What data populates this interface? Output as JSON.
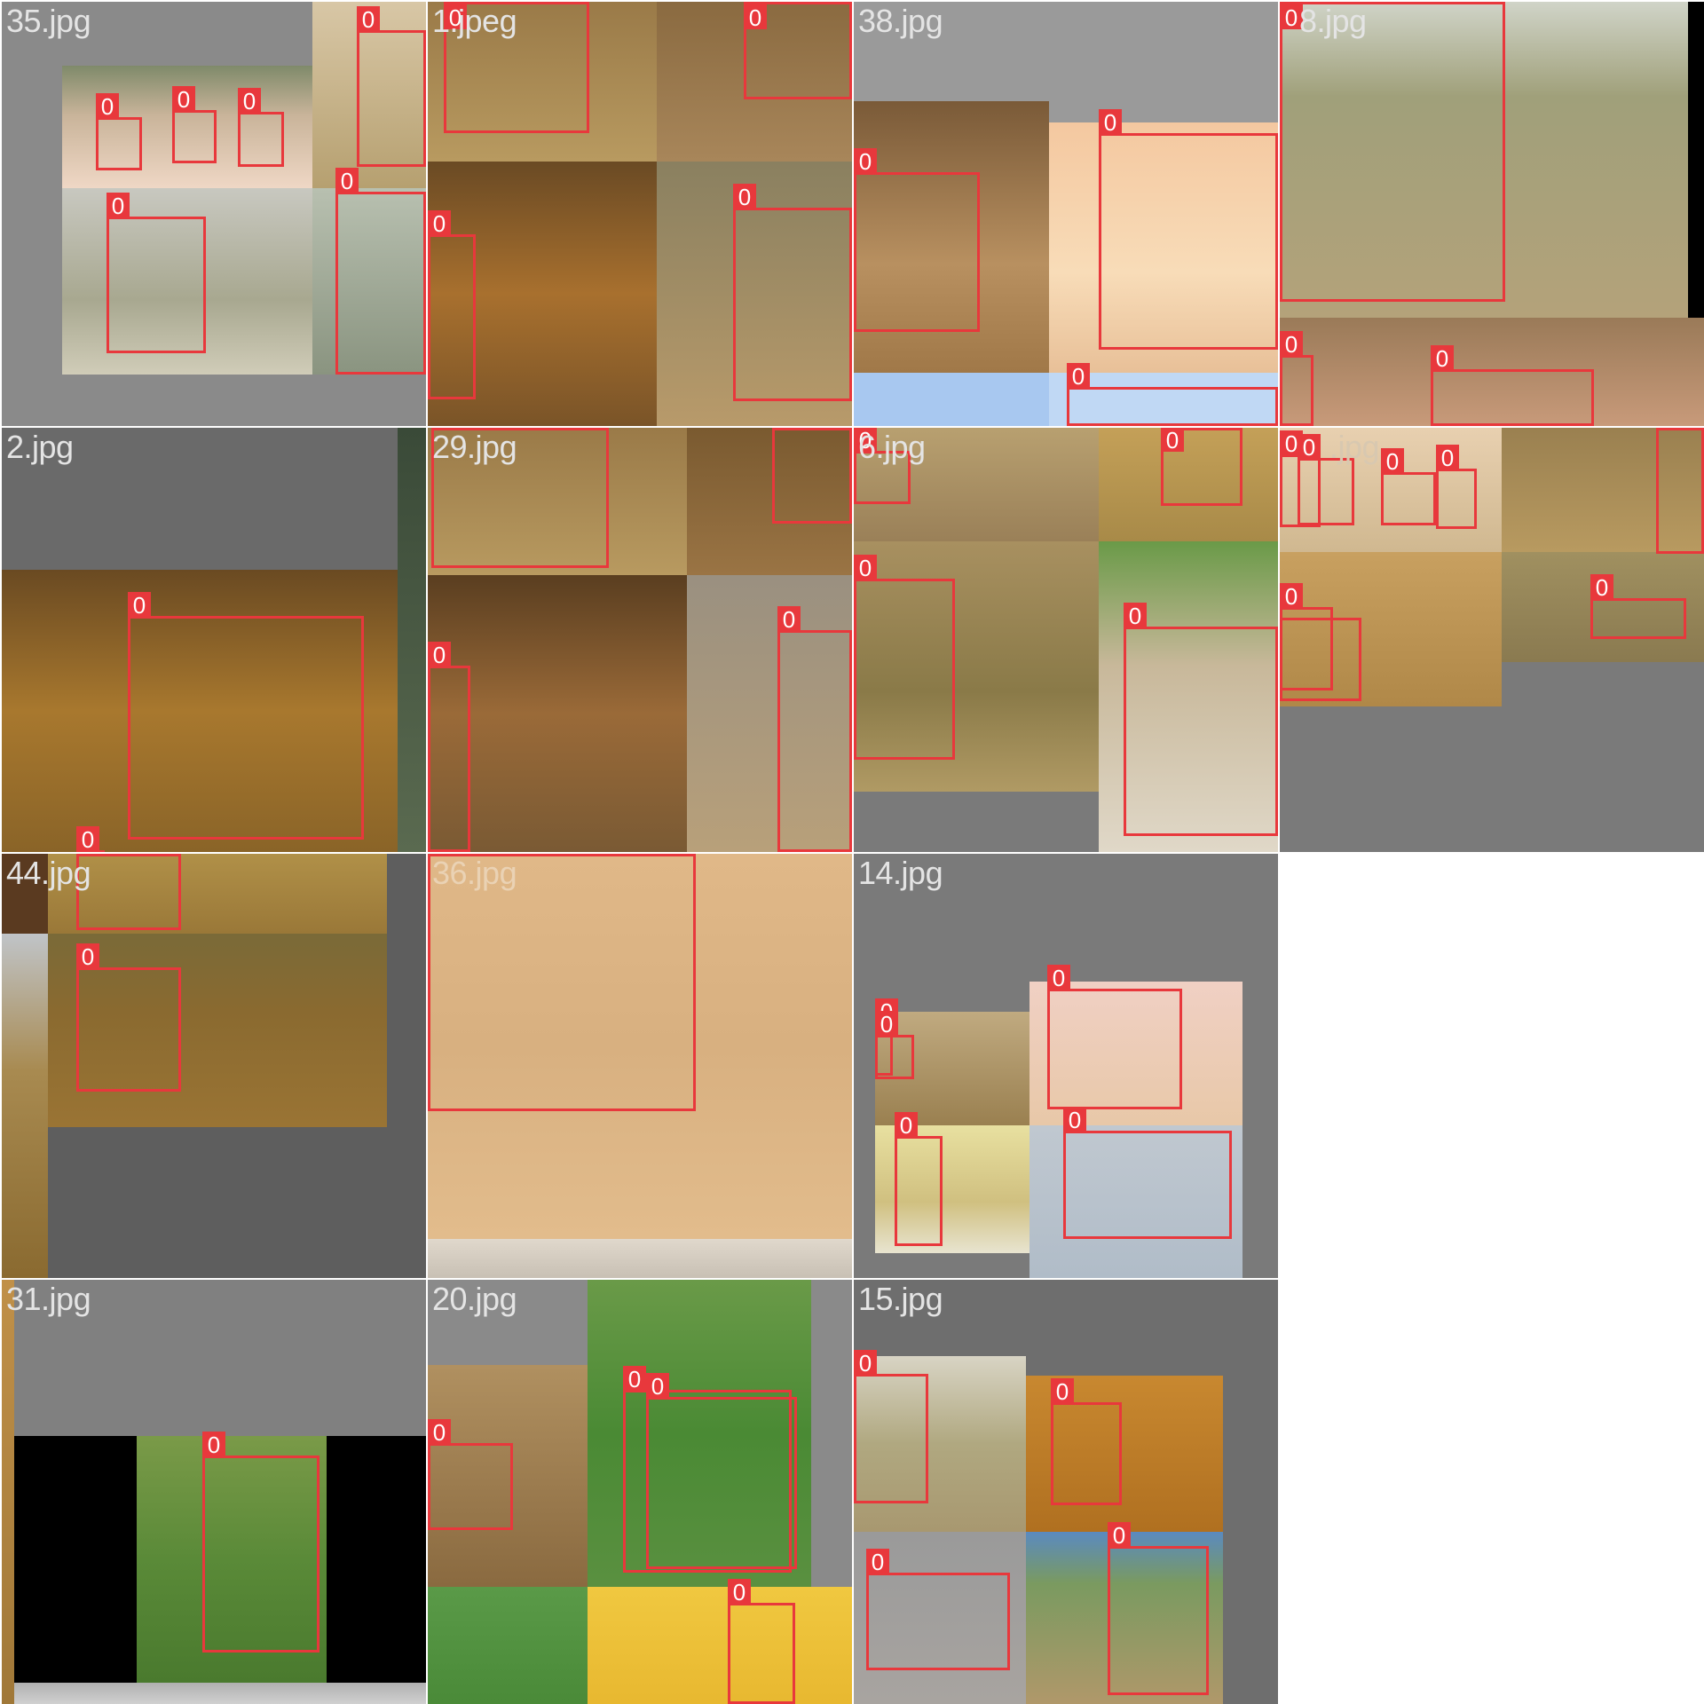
{
  "tiles": [
    {
      "name": "35.jpg"
    },
    {
      "name": "1.jpeg"
    },
    {
      "name": "38.jpg"
    },
    {
      "name": "8.jpg"
    },
    {
      "name": "2.jpg"
    },
    {
      "name": "29.jpg"
    },
    {
      "name": "6.jpg"
    },
    {
      "name": ".jpg"
    },
    {
      "name": "44.jpg"
    },
    {
      "name": "36.jpg"
    },
    {
      "name": "14.jpg"
    },
    {
      "name": "31.jpg"
    },
    {
      "name": "20.jpg"
    },
    {
      "name": "15.jpg"
    }
  ],
  "class_label": "0",
  "colors": {
    "box": "#e8383c",
    "padding_gray": "#8a8a8a",
    "dark_gray": "#5e5e5e"
  }
}
